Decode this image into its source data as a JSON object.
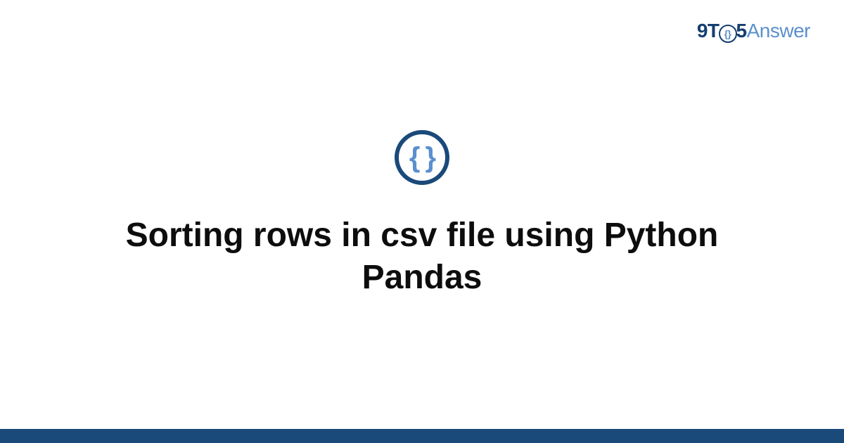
{
  "logo": {
    "part1": "9T",
    "o_inner": "{}",
    "part2": "5",
    "part3": "Answer"
  },
  "badge": {
    "glyph": "{ }"
  },
  "title": "Sorting rows in csv file using Python Pandas"
}
